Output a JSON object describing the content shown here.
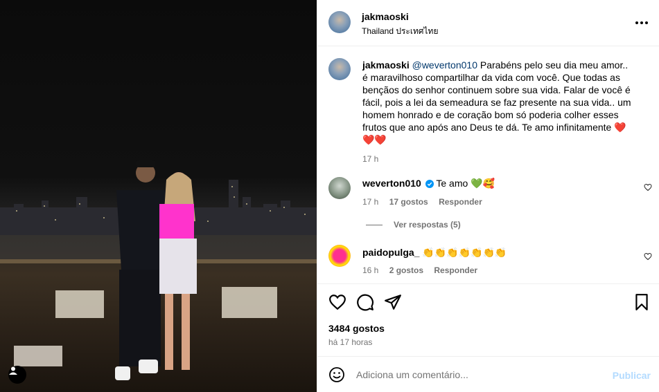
{
  "post": {
    "author": "jakmaoski",
    "location": "Thailand ประเทศไทย"
  },
  "caption": {
    "author": "jakmaoski",
    "mention": "@weverton010",
    "text": " Parabéns pelo seu dia meu amor.. é maravilhoso compartilhar da vida com você. Que todas as bençãos do senhor continuem sobre sua vida. Falar de você é fácil, pois a lei da semeadura se faz presente na sua vida.. um homem honrado e de coração bom só poderia colher esses frutos que ano após ano Deus te dá. Te amo infinitamente ",
    "emoji": "❤️❤️❤️",
    "time": "17 h"
  },
  "comments": [
    {
      "author": "weverton010",
      "text": "Te amo 💚🥰",
      "time": "17 h",
      "likes": "17 gostos",
      "reply": "Responder"
    },
    {
      "author": "paidopulga_",
      "text": "👏👏👏👏👏👏👏",
      "time": "16 h",
      "likes": "2 gostos",
      "reply": "Responder"
    }
  ],
  "view_replies": "Ver respostas (5)",
  "likes_count": "3484 gostos",
  "posted_ago": "há 17 horas",
  "composer": {
    "placeholder": "Adiciona um comentário...",
    "publish_label": "Publicar"
  },
  "icons": [
    "more-icon",
    "heart-icon",
    "comment-icon",
    "share-icon",
    "bookmark-icon",
    "emoji-icon",
    "verified-icon",
    "user-tag-icon"
  ],
  "colors": {
    "link": "#00376b",
    "muted": "#737373",
    "publish_disabled": "#b3dbff",
    "verified": "#0095f6"
  }
}
